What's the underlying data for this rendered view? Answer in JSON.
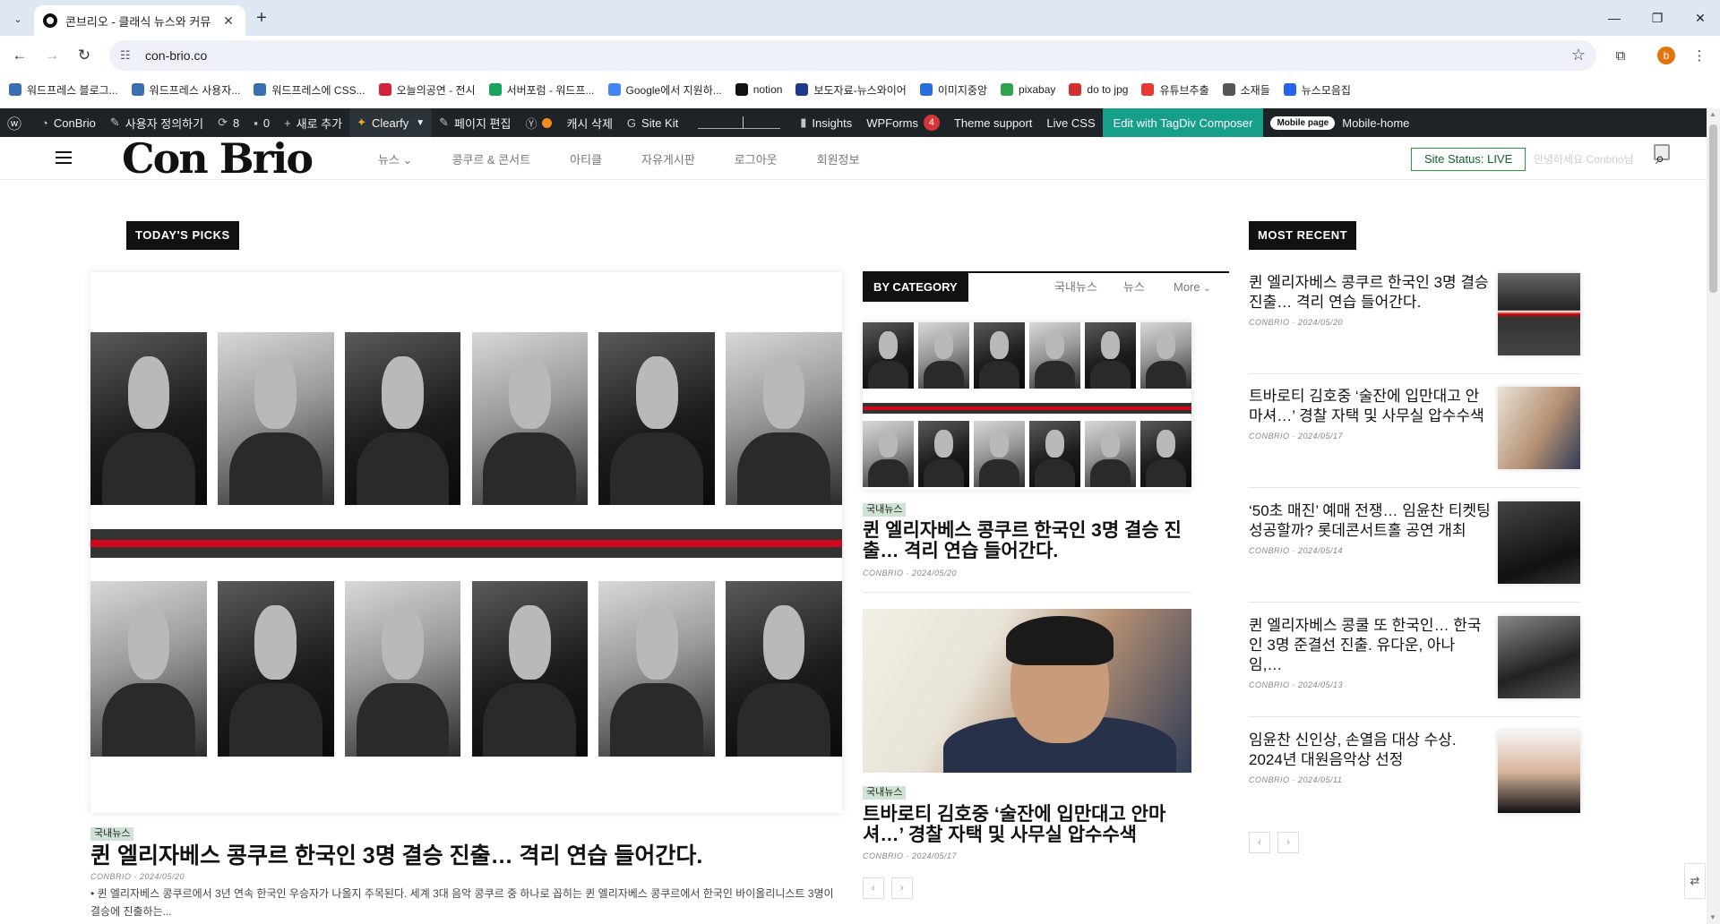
{
  "browser": {
    "tab_title": "콘브리오 - 클래식 뉴스와 커뮤",
    "url": "con-brio.co",
    "bookmarks": [
      {
        "label": "워드프레스 블로그...",
        "color": "#3a6fb0"
      },
      {
        "label": "워드프레스 사용자...",
        "color": "#3a6fb0"
      },
      {
        "label": "워드프레스에 CSS...",
        "color": "#3a6fb0"
      },
      {
        "label": "오늘의공연 - 전시",
        "color": "#d3213b"
      },
      {
        "label": "서버포럼 - 워드프...",
        "color": "#1aa35a"
      },
      {
        "label": "Google에서 지원하...",
        "color": "#4285f4"
      },
      {
        "label": "notion",
        "color": "#111111"
      },
      {
        "label": "보도자료-뉴스와이어",
        "color": "#1e3a8a"
      },
      {
        "label": "이미지중앙",
        "color": "#2b6de0"
      },
      {
        "label": "pixabay",
        "color": "#2ea44f"
      },
      {
        "label": "do to jpg",
        "color": "#d32f2f"
      },
      {
        "label": "유튜브추출",
        "color": "#e53935"
      },
      {
        "label": "소재들",
        "color": "#555555"
      },
      {
        "label": "뉴스모음집",
        "color": "#2563eb"
      }
    ]
  },
  "adminbar": {
    "site_name": "ConBrio",
    "customize": "사용자 정의하기",
    "updates_count": "8",
    "comments_count": "0",
    "new_label": "새로 추가",
    "clearfy_label": "Clearfy",
    "edit_page": "페이지 편집",
    "cache_delete": "캐시 삭제",
    "site_kit": "Site Kit",
    "insights": "Insights",
    "wpforms": "WPForms",
    "wpforms_count": "4",
    "theme_support": "Theme support",
    "live_css": "Live CSS",
    "tagdiv": "Edit with TagDiv Composer",
    "mobile_page": "Mobile page",
    "mobile_home": "Mobile-home"
  },
  "site": {
    "logo": "Con Brio",
    "nav": [
      "뉴스",
      "콩쿠르 & 콘서트",
      "아티클",
      "자유게시판",
      "로그아웃",
      "회원정보"
    ],
    "site_status": "Site Status: LIVE",
    "greeting": "안녕하세요 Conbrio님"
  },
  "todays_picks": {
    "label": "TODAY'S PICKS",
    "category": "국내뉴스",
    "headline": "퀸 엘리자베스 콩쿠르 한국인 3명 결승 진출… 격리 연습 들어간다.",
    "author": "CONBRIO",
    "date": "2024/05/20",
    "excerpt": "퀸 엘리자베스 콩쿠르에서 3년 연속 한국인 우승자가 나올지 주목된다. 세계 3대 음악 콩쿠르 중 하나로 꼽히는 퀸 엘리자베스 콩쿠르에서 한국인 바이올리니스트 3명이 결승에 진출하는..."
  },
  "by_category": {
    "label": "BY CATEGORY",
    "filters": [
      "국내뉴스",
      "뉴스",
      "More"
    ],
    "posts": [
      {
        "category": "국내뉴스",
        "title": "퀸 엘리자베스 콩쿠르 한국인 3명 결승 진출… 격리 연습 들어간다.",
        "author": "CONBRIO",
        "date": "2024/05/20"
      },
      {
        "category": "국내뉴스",
        "title": "트바로티 김호중 ‘술잔에 입만대고 안마셔…’ 경찰 자택 및 사무실 압수수색",
        "author": "CONBRIO",
        "date": "2024/05/17"
      }
    ],
    "prev": "‹",
    "next": "›"
  },
  "most_recent": {
    "label": "MOST RECENT",
    "items": [
      {
        "title": "퀸 엘리자베스 콩쿠르 한국인 3명 결승 진출… 격리 연습 들어간다.",
        "author": "CONBRIO",
        "date": "2024/05/20"
      },
      {
        "title": "트바로티 김호중 ‘술잔에 입만대고 안마셔…’ 경찰 자택 및 사무실 압수수색",
        "author": "CONBRIO",
        "date": "2024/05/17"
      },
      {
        "title": "‘50초 매진’ 예매 전쟁… 임윤찬 티켓팅 성공할까? 롯데콘서트홀 공연 개최",
        "author": "CONBRIO",
        "date": "2024/05/14"
      },
      {
        "title": "퀸 엘리자베스 콩쿨 또 한국인… 한국인 3명 준결선 진출. 유다운, 아나 임,…",
        "author": "CONBRIO",
        "date": "2024/05/13"
      },
      {
        "title": "임윤찬 신인상, 손열음 대상 수상. 2024년 대원음악상 선정",
        "author": "CONBRIO",
        "date": "2024/05/11"
      }
    ],
    "prev": "‹",
    "next": "›"
  }
}
